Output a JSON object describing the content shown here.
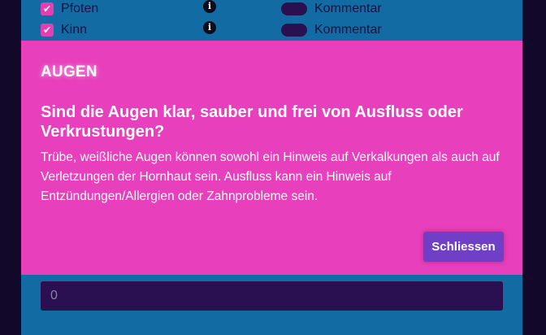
{
  "background_rows": [
    {
      "label": "Pfoten",
      "checked": true,
      "toggle_label": "Kommentar",
      "info_icon": "info-icon"
    },
    {
      "label": "Kinn",
      "checked": true,
      "toggle_label": "Kommentar",
      "info_icon": "info-icon"
    }
  ],
  "background_input": {
    "value": "0"
  },
  "modal": {
    "header": "AUGEN",
    "question": "Sind die Augen klar, sauber und frei von Ausfluss oder Verkrustungen?",
    "body": "Trübe, weißliche Augen können sowohl ein Hinweis auf Verkalkungen als auch auf Verletzungen der Hornhaut sein. Ausfluss kann ein Hinweis auf Entzündungen/Allergien oder Zahnprobleme sein.",
    "close_label": "Schliessen"
  },
  "colors": {
    "modal_bg": "#e83fbc",
    "button_bg": "#6f3fc8",
    "panel_bg": "#136ba3",
    "page_bg": "#12082a"
  }
}
